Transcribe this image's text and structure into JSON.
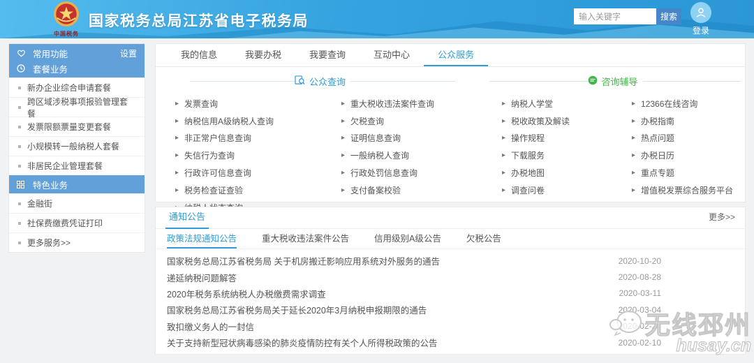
{
  "header": {
    "title": "国家税务总局江苏省电子税务局",
    "logo_caption": "中国税务",
    "search_placeholder": "输入关键字",
    "search_button": "搜索",
    "login_label": "登录"
  },
  "sidebar": {
    "common_header": "常用功能",
    "settings_label": "设置",
    "package_header": "套餐业务",
    "package_items": [
      "新办企业综合申请套餐",
      "跨区域涉税事项报验管理套餐",
      "发票限额票量变更套餐",
      "小规模转一般纳税人套餐",
      "非居民企业管理套餐"
    ],
    "special_header": "特色业务",
    "special_items": [
      "金融街",
      "社保费缴费凭证打印",
      "更多服务>>"
    ]
  },
  "tabs": [
    "我的信息",
    "我要办税",
    "我要查询",
    "互动中心",
    "公众服务"
  ],
  "active_tab": "公众服务",
  "public_query": {
    "title": "公众查询",
    "col1": [
      "发票查询",
      "纳税信用A级纳税人查询",
      "非正常户信息查询",
      "失信行为查询",
      "行政许可信息查询",
      "税务检查证查验",
      "纳税人状态查询"
    ],
    "col2": [
      "重大税收违法案件查询",
      "欠税查询",
      "证明信息查询",
      "一般纳税人查询",
      "行政处罚信息查询",
      "支付备案校验"
    ]
  },
  "consult": {
    "title": "咨询辅导",
    "col1": [
      "纳税人学堂",
      "税收政策及解读",
      "操作规程",
      "下载服务",
      "办税地图",
      "调查问卷"
    ],
    "col2": [
      "12366在线咨询",
      "办税指南",
      "热点问题",
      "办税日历",
      "重点专题",
      "增值税发票综合服务平台"
    ]
  },
  "notices": {
    "title": "通知公告",
    "more_label": "更多>>",
    "tabs": [
      "政策法规通知公告",
      "重大税收违法案件公告",
      "信用级别A级公告",
      "欠税公告"
    ],
    "active_tab": "政策法规通知公告",
    "items": [
      {
        "title": "国家税务总局江苏省税务局 关于机房搬迁影响应用系统对外服务的通告",
        "date": "2020-10-20"
      },
      {
        "title": "递延纳税问题解答",
        "date": "2020-08-28"
      },
      {
        "title": "2020年税务系统纳税人办税缴费需求调查",
        "date": "2020-03-11"
      },
      {
        "title": "国家税务总局江苏省税务局关于延长2020年3月纳税申报期限的通告",
        "date": "2020-03-04"
      },
      {
        "title": "致扣缴义务人的一封信",
        "date": "2020-02-28"
      },
      {
        "title": "关于支持新型冠状病毒感染的肺炎疫情防控有关个人所得税政策的公告",
        "date": "2020-02-10"
      }
    ]
  },
  "watermark": {
    "name": "无线邳州",
    "site": "husay.cn"
  },
  "colors": {
    "accent_blue": "#2e9cd6",
    "accent_green": "#44b549",
    "sidebar_blue": "#62a0da",
    "header_blue": "#34a3df",
    "search_button_blue": "#4687ca"
  }
}
